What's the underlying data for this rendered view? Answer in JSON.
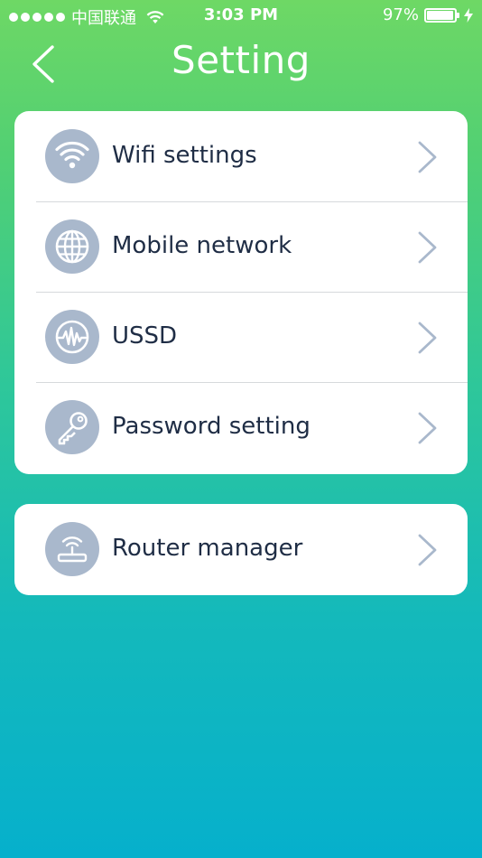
{
  "status_bar": {
    "carrier": "中国联通",
    "time": "3:03 PM",
    "battery_percent_text": "97%",
    "battery_level": 0.97
  },
  "header": {
    "title": "Setting",
    "back_icon": "chevron-left-icon"
  },
  "settings_group_1": {
    "items": [
      {
        "label": "Wifi settings",
        "icon": "wifi-icon"
      },
      {
        "label": "Mobile network",
        "icon": "globe-icon"
      },
      {
        "label": "USSD",
        "icon": "waveform-icon"
      },
      {
        "label": "Password setting",
        "icon": "key-icon"
      }
    ]
  },
  "settings_group_2": {
    "items": [
      {
        "label": "Router manager",
        "icon": "router-icon"
      }
    ]
  },
  "colors": {
    "gradient_top": "#6ed865",
    "gradient_bottom": "#06b0cc",
    "card_background": "#ffffff",
    "icon_circle": "#a9b8cc",
    "label_text": "#1f2d45",
    "chevron": "#a9b8cc",
    "divider": "#d6d9dc"
  }
}
